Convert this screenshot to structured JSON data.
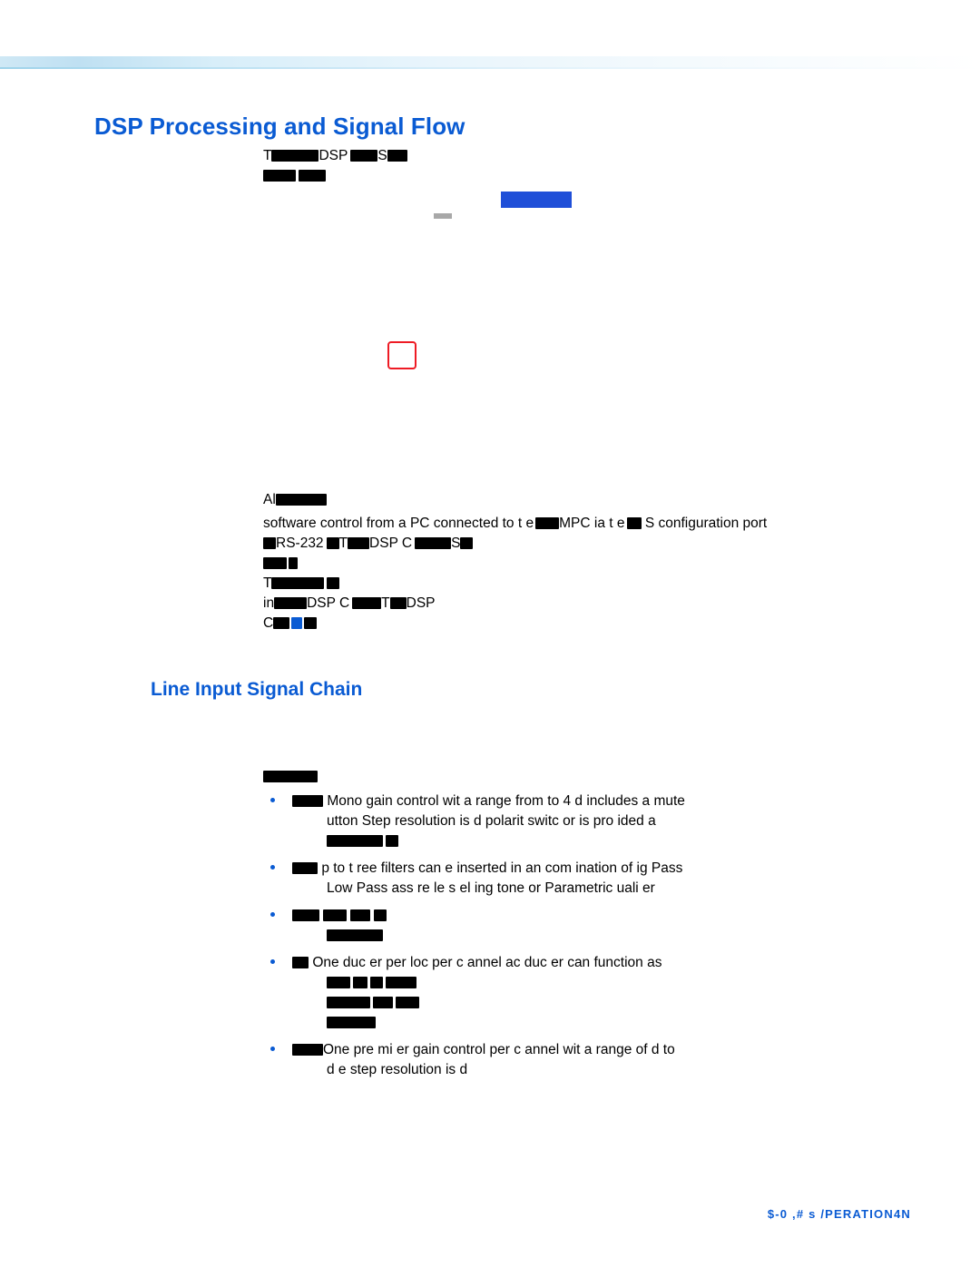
{
  "page": {
    "title": "DSP Processing and Signal Flow",
    "section_heading": "Line Input Signal Chain",
    "footer": "$-0   ,# s /PERATION",
    "footer_page": "4"
  },
  "intro": {
    "line1_pre": "T",
    "line1_a": "DSP",
    "line1_b": "S",
    "line2": "",
    "para2_line1_pre": "Al",
    "para2_line1_mid": "software control from a PC connected to t",
    "para2_line1_b": "e",
    "para2_line1_c": "MPC",
    "para2_line1_d": "ia t",
    "para2_line1_e": "e",
    "para2_line1_f": "S",
    "para2_line1_g": "configuration port",
    "para2_line2_a": "RS-232",
    "para2_line2_b": "T",
    "para2_line2_c": "DSP C",
    "para2_line2_d": "S",
    "para3_line1": "T",
    "para3_line2_a": "in",
    "para3_line2_b": "DSP C",
    "para3_line2_c": "T",
    "para3_line2_d": "DSP",
    "para3_line3": "C"
  },
  "line_input": {
    "lead": "",
    "bullets": [
      {
        "id": "gain",
        "lines": [
          "Mono gain control wit   a range from          to       4 d    includes a mute",
          "utton   Step resolution is          d          polarit    switc        or    is pro  ided        a",
          ""
        ]
      },
      {
        "id": "filters",
        "lines": [
          "p to t   ree filters can   e inserted in an   com   ination of   ig   Pass",
          "Low Pass      ass    re  le s  el  ing   tone     or Parametric     uali   er"
        ]
      },
      {
        "id": "delay",
        "lines": [
          "",
          ""
        ]
      },
      {
        "id": "ducker",
        "lines": [
          "One duc   er per   loc    per c   annel        ac   duc   er can function as",
          "",
          "",
          ""
        ]
      },
      {
        "id": "premix",
        "lines": [
          "One pre  mi   er gain control per c   annel wit   a range of            d    to",
          "d            e step resolution is           d"
        ]
      }
    ]
  },
  "colors": {
    "heading_blue": "#0a5bd3",
    "rect_blue": "#1f4fd8",
    "red_outline": "#ee1b24",
    "redaction_black": "#000000"
  }
}
